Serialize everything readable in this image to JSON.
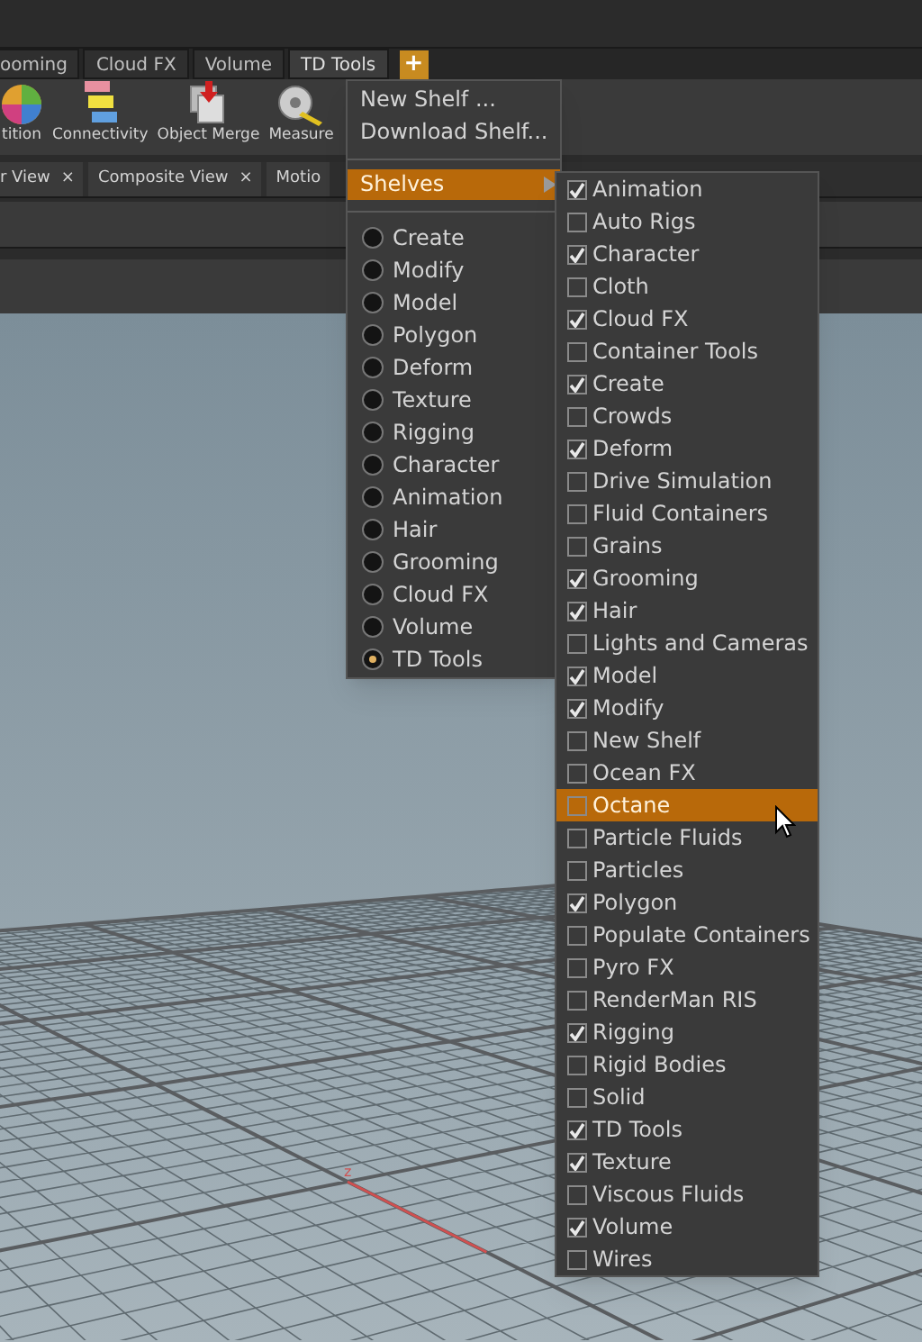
{
  "top_tabs": [
    {
      "label": "ooming",
      "selected": false
    },
    {
      "label": "Cloud FX",
      "selected": false
    },
    {
      "label": "Volume",
      "selected": false
    },
    {
      "label": "TD Tools",
      "selected": true
    }
  ],
  "add_shelf_button": "+",
  "shelf_tools": [
    {
      "label": "tition",
      "kind": "sphere"
    },
    {
      "label": "Connectivity",
      "kind": "blocks"
    },
    {
      "label": "Object Merge",
      "kind": "merge"
    },
    {
      "label": "Measure",
      "kind": "tape"
    }
  ],
  "pane_tabs": [
    {
      "label": "r View",
      "close": "×"
    },
    {
      "label": "Composite View",
      "close": "×"
    },
    {
      "label": "Motio"
    }
  ],
  "viewport": {
    "axis_label": "z"
  },
  "shelf_menu": {
    "items": [
      {
        "kind": "action",
        "label": "New Shelf ..."
      },
      {
        "kind": "action",
        "label": "Download Shelf..."
      },
      {
        "kind": "separator"
      },
      {
        "kind": "submenu",
        "label": "Shelves",
        "highlighted": true
      },
      {
        "kind": "separator"
      },
      {
        "kind": "radio",
        "label": "Create",
        "selected": false
      },
      {
        "kind": "radio",
        "label": "Modify",
        "selected": false
      },
      {
        "kind": "radio",
        "label": "Model",
        "selected": false
      },
      {
        "kind": "radio",
        "label": "Polygon",
        "selected": false
      },
      {
        "kind": "radio",
        "label": "Deform",
        "selected": false
      },
      {
        "kind": "radio",
        "label": "Texture",
        "selected": false
      },
      {
        "kind": "radio",
        "label": "Rigging",
        "selected": false
      },
      {
        "kind": "radio",
        "label": "Character",
        "selected": false
      },
      {
        "kind": "radio",
        "label": "Animation",
        "selected": false
      },
      {
        "kind": "radio",
        "label": "Hair",
        "selected": false
      },
      {
        "kind": "radio",
        "label": "Grooming",
        "selected": false
      },
      {
        "kind": "radio",
        "label": "Cloud FX",
        "selected": false
      },
      {
        "kind": "radio",
        "label": "Volume",
        "selected": false
      },
      {
        "kind": "radio",
        "label": "TD Tools",
        "selected": true
      }
    ]
  },
  "shelves_submenu": [
    {
      "label": "Animation",
      "checked": true,
      "highlighted": false
    },
    {
      "label": "Auto Rigs",
      "checked": false,
      "highlighted": false
    },
    {
      "label": "Character",
      "checked": true,
      "highlighted": false
    },
    {
      "label": "Cloth",
      "checked": false,
      "highlighted": false
    },
    {
      "label": "Cloud FX",
      "checked": true,
      "highlighted": false
    },
    {
      "label": "Container Tools",
      "checked": false,
      "highlighted": false
    },
    {
      "label": "Create",
      "checked": true,
      "highlighted": false
    },
    {
      "label": "Crowds",
      "checked": false,
      "highlighted": false
    },
    {
      "label": "Deform",
      "checked": true,
      "highlighted": false
    },
    {
      "label": "Drive Simulation",
      "checked": false,
      "highlighted": false
    },
    {
      "label": "Fluid Containers",
      "checked": false,
      "highlighted": false
    },
    {
      "label": "Grains",
      "checked": false,
      "highlighted": false
    },
    {
      "label": "Grooming",
      "checked": true,
      "highlighted": false
    },
    {
      "label": "Hair",
      "checked": true,
      "highlighted": false
    },
    {
      "label": "Lights and Cameras",
      "checked": false,
      "highlighted": false
    },
    {
      "label": "Model",
      "checked": true,
      "highlighted": false
    },
    {
      "label": "Modify",
      "checked": true,
      "highlighted": false
    },
    {
      "label": "New Shelf",
      "checked": false,
      "highlighted": false
    },
    {
      "label": "Ocean FX",
      "checked": false,
      "highlighted": false
    },
    {
      "label": "Octane",
      "checked": false,
      "highlighted": true
    },
    {
      "label": "Particle Fluids",
      "checked": false,
      "highlighted": false
    },
    {
      "label": "Particles",
      "checked": false,
      "highlighted": false
    },
    {
      "label": "Polygon",
      "checked": true,
      "highlighted": false
    },
    {
      "label": "Populate Containers",
      "checked": false,
      "highlighted": false
    },
    {
      "label": "Pyro FX",
      "checked": false,
      "highlighted": false
    },
    {
      "label": "RenderMan RIS",
      "checked": false,
      "highlighted": false
    },
    {
      "label": "Rigging",
      "checked": true,
      "highlighted": false
    },
    {
      "label": "Rigid Bodies",
      "checked": false,
      "highlighted": false
    },
    {
      "label": "Solid",
      "checked": false,
      "highlighted": false
    },
    {
      "label": "TD Tools",
      "checked": true,
      "highlighted": false
    },
    {
      "label": "Texture",
      "checked": true,
      "highlighted": false
    },
    {
      "label": "Viscous Fluids",
      "checked": false,
      "highlighted": false
    },
    {
      "label": "Volume",
      "checked": true,
      "highlighted": false
    },
    {
      "label": "Wires",
      "checked": false,
      "highlighted": false
    }
  ]
}
